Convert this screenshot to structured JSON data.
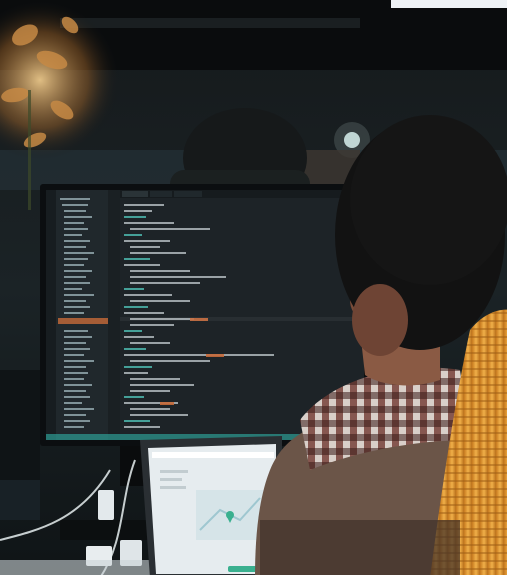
{
  "scene": {
    "subject": "developer-at-workstation",
    "primary_screen": "code-editor",
    "secondary_screen": "laptop-map-view"
  },
  "colors": {
    "background": "#0d1114",
    "monitor_screen": "#1d2327",
    "editor_sidebar": "#20282c",
    "editor_text": "#cfd8dc",
    "editor_accent": "#4db6ac",
    "highlight_orange": "#c76a3a",
    "chair": "#e8a33a",
    "shirt_check": "#8a5a4a",
    "jacket": "#6b5548",
    "hair": "#121212",
    "laptop_screen": "#e6ecef",
    "laptop_bar": "#3ab08f",
    "plant_light": "#f0c27a"
  },
  "icons": {
    "map_pin": "map-pin-icon"
  }
}
